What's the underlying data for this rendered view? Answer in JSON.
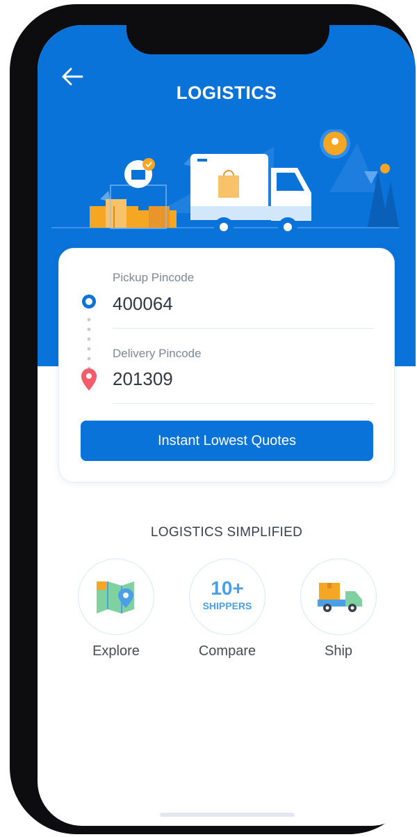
{
  "header": {
    "title": "LOGISTICS"
  },
  "form": {
    "pickup_label": "Pickup Pincode",
    "pickup_value": "400064",
    "delivery_label": "Delivery  Pincode",
    "delivery_value": "201309",
    "cta_label": "Instant Lowest Quotes"
  },
  "features": {
    "section_title": "LOGISTICS SIMPLIFIED",
    "items": [
      {
        "label": "Explore",
        "icon": "map-icon"
      },
      {
        "label": "Compare",
        "icon": "shippers-badge-icon",
        "badge_number": "10+",
        "badge_text": "SHIPPERS"
      },
      {
        "label": "Ship",
        "icon": "delivery-truck-icon"
      }
    ]
  },
  "colors": {
    "primary": "#0a73d9",
    "accent_orange": "#f5a623",
    "pin_red": "#f25c6b"
  }
}
